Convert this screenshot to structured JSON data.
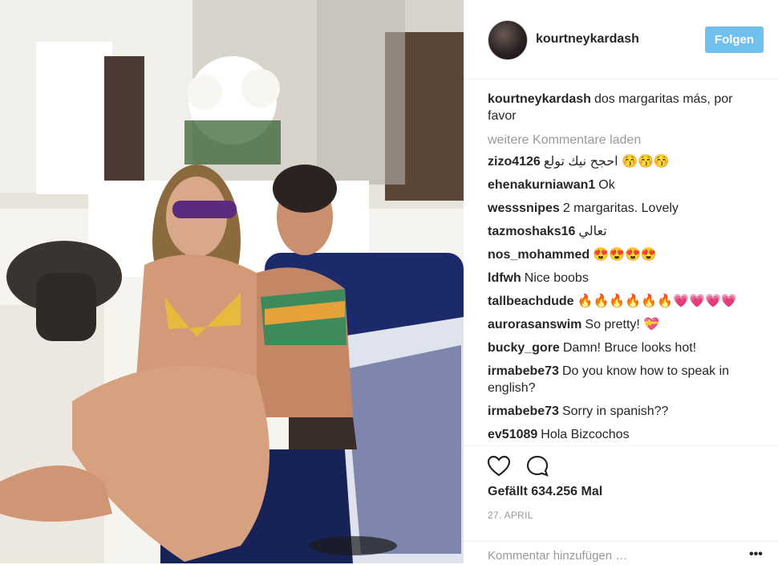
{
  "post": {
    "username": "kourtneykardash",
    "follow_label": "Folgen",
    "photo_description": "",
    "caption_user": "kourtneykardash",
    "caption_text": "dos margaritas más, por favor",
    "load_more": "weitere Kommentare laden",
    "comments": [
      {
        "user": "zizo4126",
        "text": "احجح نيك تولع 😚😚😚"
      },
      {
        "user": "ehenakurniawan1",
        "text": "Ok"
      },
      {
        "user": "wesssnipes",
        "text": "2 margaritas. Lovely"
      },
      {
        "user": "tazmoshaks16",
        "text": "تعالي"
      },
      {
        "user": "nos_mohammed",
        "text": "😍😍😍😍"
      },
      {
        "user": "ldfwh",
        "text": "Nice boobs"
      },
      {
        "user": "tallbeachdude",
        "text": "🔥🔥🔥🔥🔥🔥💗💗💗💗"
      },
      {
        "user": "aurorasanswim",
        "text": "So pretty! 💝"
      },
      {
        "user": "bucky_gore",
        "text": "Damn! Bruce looks hot!"
      },
      {
        "user": "irmabebe73",
        "text": "Do you know how to speak in english?"
      },
      {
        "user": "irmabebe73",
        "text": "Sorry in spanish??"
      },
      {
        "user": "ev51089",
        "text": "Hola Bizcochos"
      }
    ],
    "likes": "Gefällt 634.256 Mal",
    "date": "27. APRIL",
    "comment_placeholder": "Kommentar hinzufügen …",
    "more_label": "•••",
    "icons": {
      "like": "heart-icon",
      "comment": "comment-bubble-icon",
      "more": "more-options-icon"
    }
  }
}
